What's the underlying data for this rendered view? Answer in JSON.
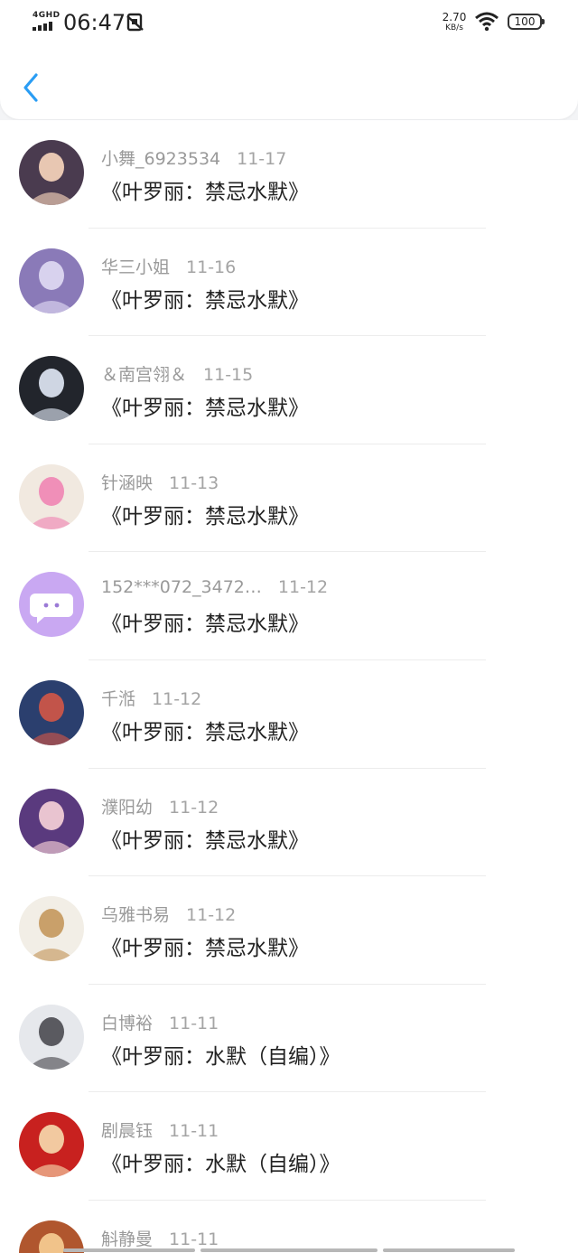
{
  "status_bar": {
    "network": "4GHD",
    "time": "06:47",
    "sim_icon": "no-sim-icon",
    "speed_value": "2.70",
    "speed_unit": "KB/s",
    "wifi_icon": "wifi-icon",
    "battery": "100"
  },
  "header": {
    "back_icon": "chevron-left-icon",
    "accent": "#2a9df4"
  },
  "works": [
    {
      "name": "小舞_6923534",
      "date": "11-17",
      "title": "《叶罗丽：禁忌水默》",
      "avatar_colors": [
        "#4a3b4f",
        "#e8c7b2"
      ]
    },
    {
      "name": "华三小姐",
      "date": "11-16",
      "title": "《叶罗丽：禁忌水默》",
      "avatar_colors": [
        "#8a7ab8",
        "#d8d2ee"
      ]
    },
    {
      "name": "＆南宫翎＆",
      "date": "11-15",
      "title": "《叶罗丽：禁忌水默》",
      "avatar_colors": [
        "#22252c",
        "#cfd6e3"
      ]
    },
    {
      "name": "针涵映",
      "date": "11-13",
      "title": "《叶罗丽：禁忌水默》",
      "avatar_colors": [
        "#f1e9e0",
        "#f08fb8"
      ]
    },
    {
      "name": "152***072_3472…",
      "date": "11-12",
      "title": "《叶罗丽：禁忌水默》",
      "avatar_colors": [
        "#c9a8f2",
        "#ffffff"
      ]
    },
    {
      "name": "千湉",
      "date": "11-12",
      "title": "《叶罗丽：禁忌水默》",
      "avatar_colors": [
        "#2b3f6e",
        "#c2544a"
      ]
    },
    {
      "name": "濮阳幼",
      "date": "11-12",
      "title": "《叶罗丽：禁忌水默》",
      "avatar_colors": [
        "#5a3a7e",
        "#e9c4d0"
      ]
    },
    {
      "name": "乌雅书易",
      "date": "11-12",
      "title": "《叶罗丽：禁忌水默》",
      "avatar_colors": [
        "#f2eee6",
        "#c9a06a"
      ]
    },
    {
      "name": "白博裕",
      "date": "11-11",
      "title": "《叶罗丽：水默（自编）》",
      "avatar_colors": [
        "#e6e8ec",
        "#5a5a60"
      ]
    },
    {
      "name": "剧晨钰",
      "date": "11-11",
      "title": "《叶罗丽：水默（自编）》",
      "avatar_colors": [
        "#c8211f",
        "#f2c9a0"
      ]
    },
    {
      "name": "斛静曼",
      "date": "11-11",
      "title": "",
      "avatar_colors": [
        "#b0562e",
        "#f1c38a"
      ]
    }
  ]
}
